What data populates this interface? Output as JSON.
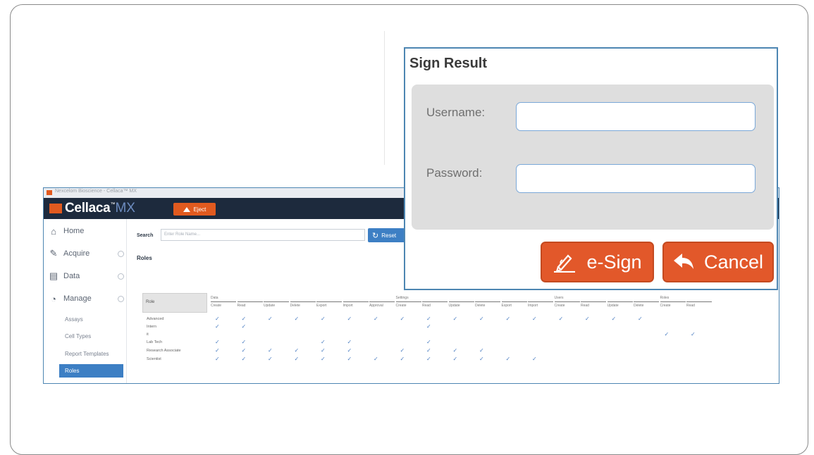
{
  "app": {
    "window_title": "Nexcelom Bioscience - Cellaca™ MX",
    "logo_text": "Cellaca",
    "logo_tm": "™",
    "logo_suffix": "MX",
    "eject_label": "Eject"
  },
  "sidebar": {
    "items": [
      {
        "label": "Home",
        "icon": "home-icon"
      },
      {
        "label": "Acquire",
        "icon": "acquire-icon"
      },
      {
        "label": "Data",
        "icon": "data-icon"
      },
      {
        "label": "Manage",
        "icon": "manage-icon"
      }
    ],
    "subitems": [
      "Assays",
      "Cell Types",
      "Report Templates",
      "Roles"
    ],
    "active_subitem": "Roles"
  },
  "search": {
    "label": "Search",
    "placeholder": "Enter Role Name..."
  },
  "reset_label": "Reset",
  "roles_title": "Roles",
  "permissions": {
    "role_header": "Role",
    "groups": [
      {
        "label": "Data",
        "start": 0
      },
      {
        "label": "Settings",
        "start": 7
      },
      {
        "label": "Users",
        "start": 13
      },
      {
        "label": "Roles",
        "start": 17
      }
    ],
    "columns": [
      "Create",
      "Read",
      "Update",
      "Delete",
      "Export",
      "Import",
      "Approval",
      "Create",
      "Read",
      "Update",
      "Delete",
      "Export",
      "Import",
      "Create",
      "Read",
      "Update",
      "Delete",
      "Create",
      "Read"
    ],
    "rows": [
      {
        "role": "Advanced",
        "checks": [
          0,
          1,
          2,
          3,
          4,
          5,
          6,
          7,
          8,
          9,
          10,
          11,
          12,
          13,
          14,
          15,
          16
        ]
      },
      {
        "role": "Intern",
        "checks": [
          0,
          1,
          8
        ]
      },
      {
        "role": "it",
        "checks": [
          17,
          18
        ]
      },
      {
        "role": "Lab Tech",
        "checks": [
          0,
          1,
          4,
          5,
          8
        ]
      },
      {
        "role": "Research Associate",
        "checks": [
          0,
          1,
          2,
          3,
          4,
          5,
          7,
          8,
          9,
          10
        ]
      },
      {
        "role": "Scientist",
        "checks": [
          0,
          1,
          2,
          3,
          4,
          5,
          6,
          7,
          8,
          9,
          10,
          11,
          12
        ]
      }
    ]
  },
  "dialog": {
    "title": "Sign Result",
    "username_label": "Username:",
    "password_label": "Password:",
    "username_value": "",
    "password_value": "",
    "esign_label": "e-Sign",
    "cancel_label": "Cancel"
  },
  "colors": {
    "accent_orange": "#e2582a",
    "window_border": "#4d86b2",
    "topbar": "#1d2a3d",
    "active_blue": "#3d7fc4"
  }
}
